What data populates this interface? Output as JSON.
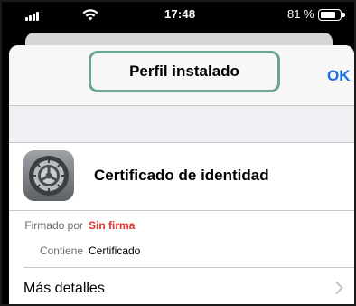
{
  "status_bar": {
    "time": "17:48",
    "battery_pct": "81 %",
    "battery_level": 0.81
  },
  "navbar": {
    "title": "Perfil instalado",
    "ok_label": "OK",
    "accent_color": "#1a6fde",
    "highlight_color": "#6ba58f"
  },
  "profile": {
    "name": "Certificado de identidad",
    "icon": "settings-gear-icon"
  },
  "details": [
    {
      "label": "Firmado por",
      "value": "Sin firma",
      "value_color": "#e0302b"
    },
    {
      "label": "Contiene",
      "value": "Certificado",
      "value_color": "#000000"
    }
  ],
  "more": {
    "label": "Más detalles",
    "icon": "chevron-right-icon"
  }
}
